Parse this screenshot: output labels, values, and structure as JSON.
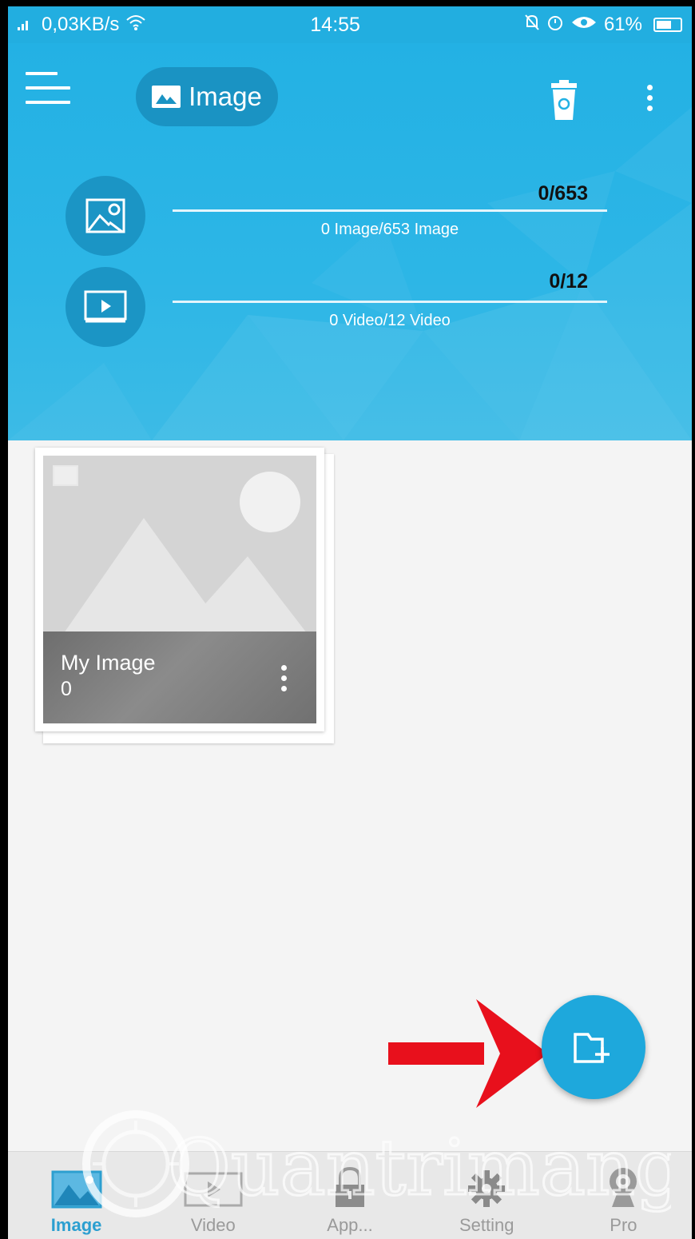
{
  "status_bar": {
    "network": "0,03KB/s",
    "time": "14:55",
    "battery": "61%"
  },
  "header": {
    "title": "Image",
    "image_stat": {
      "count": "0/653",
      "caption": "0 Image/653 Image"
    },
    "video_stat": {
      "count": "0/12",
      "caption": "0 Video/12 Video"
    }
  },
  "album": {
    "name": "My Image",
    "count": "0"
  },
  "bottom_nav": {
    "items": [
      {
        "label": "Image",
        "icon": "image-icon",
        "active": true
      },
      {
        "label": "Video",
        "icon": "video-icon",
        "active": false
      },
      {
        "label": "App...",
        "icon": "lock-icon",
        "active": false
      },
      {
        "label": "Setting",
        "icon": "gear-icon",
        "active": false
      },
      {
        "label": "Pro",
        "icon": "webcam-icon",
        "active": false
      }
    ]
  },
  "watermark": "Quantrimang",
  "colors": {
    "header_blue": "#23b1e4",
    "fab_blue": "#1ea8dc",
    "arrow_red": "#e8101c",
    "active_nav": "#2c9fd0"
  }
}
